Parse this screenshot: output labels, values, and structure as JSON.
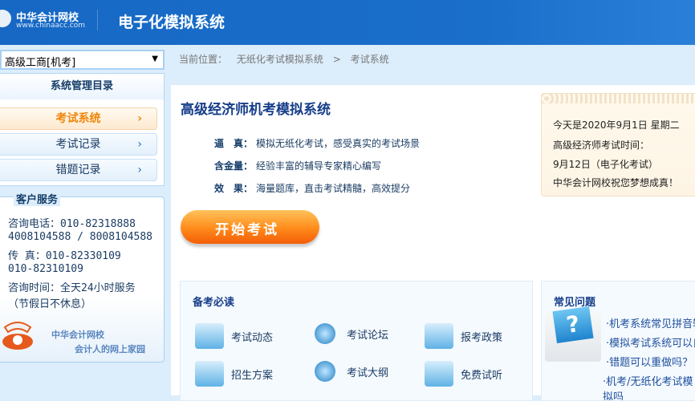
{
  "header": {
    "logo_cn": "中华会计网校",
    "logo_en": "www.chinaacc.com",
    "title": "电子化模拟系统"
  },
  "sidebar": {
    "select_value": "高级工商[机考]",
    "select_arrow": "▼",
    "menu_title": "系统管理目录",
    "items": [
      {
        "label": "考试系统",
        "active": true
      },
      {
        "label": "考试记录"
      },
      {
        "label": "错题记录"
      }
    ],
    "chevron": "›",
    "service": {
      "title": "客户服务",
      "lines": [
        "咨询电话：010-82318888",
        "4008104588 / 8008104588",
        "传    真：010-82330109",
        "          010-82310109",
        "咨询时间：全天24小时服务",
        "       （节假日不休息）"
      ],
      "slogan1": "中华会计网校",
      "slogan2": "会计人的网上家园"
    }
  },
  "breadcrumb": {
    "label": "当前位置：",
    "items": [
      "无纸化考试模拟系统",
      "考试系统"
    ],
    "sep": ">"
  },
  "main": {
    "title": "高级经济师机考模拟系统",
    "features": [
      {
        "k": "逼　真：",
        "v": "模拟无纸化考试，感受真实的考试场景"
      },
      {
        "k": "含金量：",
        "v": "经验丰富的辅导专家精心编写"
      },
      {
        "k": "效　果：",
        "v": "海量题库，直击考试精髓，高效提分"
      }
    ],
    "start_button": "开始考试",
    "notice": [
      "今天是2020年9月1日 星期二",
      "高级经济师考试时间：",
      "9月12日（电子化考试）",
      "中华会计网校祝您梦想成真！"
    ],
    "guide": {
      "title": "备考必读",
      "links": [
        "考试动态",
        "考试论坛",
        "报考政策",
        "招生方案",
        "考试大纲",
        "免费试听"
      ]
    },
    "faq": {
      "title": "常见问题",
      "icon": "?",
      "items": [
        "·机考系统常见拼音输",
        "·模拟考试系统可以自",
        "·错题可以重做吗？",
        "·机考/无纸化考试模拟吗"
      ]
    }
  }
}
